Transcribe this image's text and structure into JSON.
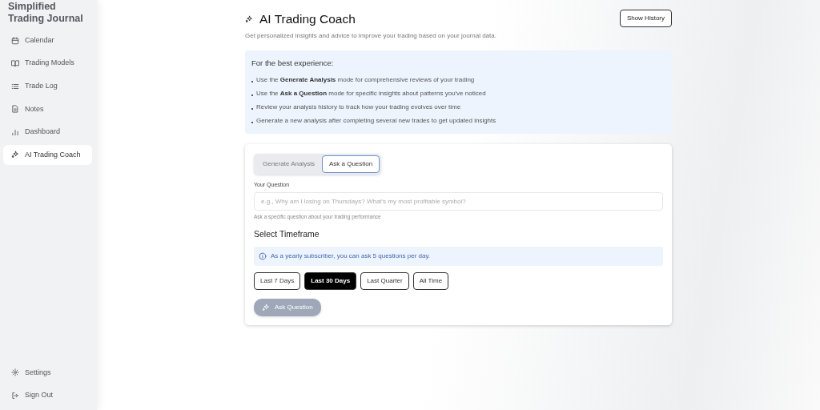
{
  "sidebar": {
    "title_lines": [
      "Simplified",
      "Trading Journal"
    ],
    "items": [
      {
        "label": "Calendar",
        "selected": false
      },
      {
        "label": "Trading Models",
        "selected": false
      },
      {
        "label": "Trade Log",
        "selected": false
      },
      {
        "label": "Notes",
        "selected": false
      },
      {
        "label": "Dashboard",
        "selected": false
      },
      {
        "label": "AI Trading Coach",
        "selected": true
      }
    ],
    "footer": [
      {
        "label": "Settings"
      },
      {
        "label": "Sign Out"
      }
    ]
  },
  "header": {
    "title": "AI Trading Coach",
    "subtitle": "Get personalized insights and advice to improve your trading based on your journal data.",
    "history_button": "Show History"
  },
  "tips": {
    "heading": "For the best experience:",
    "items": [
      "Use the **Generate Analysis** mode for comprehensive reviews of your trading",
      "Use the **Ask a Question** mode for specific insights about patterns you've noticed",
      "Review your analysis history to track how your trading evolves over time",
      "Generate a new analysis after completing several new trades to get updated insights"
    ]
  },
  "modes": [
    {
      "label": "Generate Analysis",
      "selected": false
    },
    {
      "label": "Ask a Question",
      "selected": true
    }
  ],
  "question": {
    "label": "Your Question",
    "placeholder": "e.g., Why am I losing on Thursdays? What's my most profitable symbol?",
    "help": "Ask a specific question about your trading performance"
  },
  "timeframe": {
    "heading": "Select Timeframe",
    "notice": "As a yearly subscriber, you can ask 5 questions per day.",
    "options": [
      {
        "label": "Last 7 Days",
        "selected": false
      },
      {
        "label": "Last 30 Days",
        "selected": true
      },
      {
        "label": "Last Quarter",
        "selected": false
      },
      {
        "label": "All Time",
        "selected": false
      }
    ]
  },
  "submit": {
    "label": "Ask Question",
    "disabled": true
  }
}
